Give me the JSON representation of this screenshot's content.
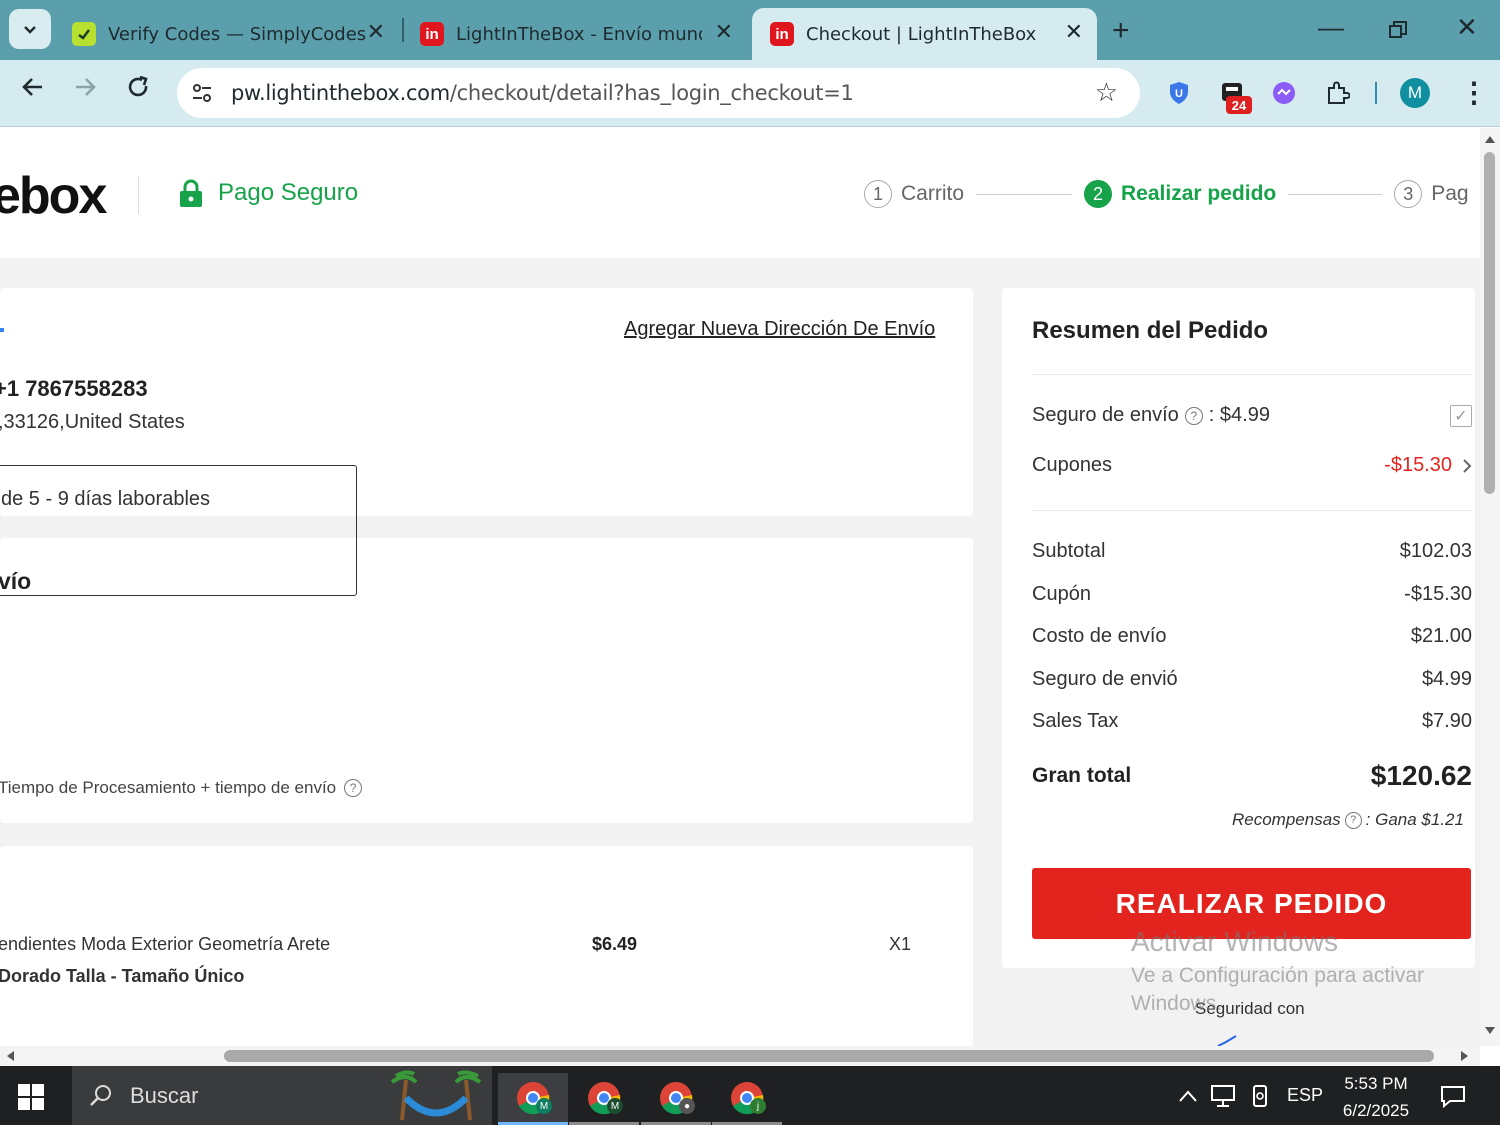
{
  "browser": {
    "tabs": [
      {
        "title": "Verify Codes — SimplyCodes",
        "favicon": "simplycodes-icon"
      },
      {
        "title": "LightInTheBox - Envío mundial",
        "favicon": "lightinthebox-icon"
      },
      {
        "title": "Checkout | LightInTheBox",
        "favicon": "lightinthebox-icon"
      }
    ],
    "url_host": "pw.lightinthebox.com",
    "url_path": "/checkout/detail?has_login_checkout=1",
    "ext_badge": "24",
    "profile_initial": "M"
  },
  "header": {
    "logo": "ebox",
    "secure_label": "Pago Seguro",
    "steps": [
      {
        "num": "1",
        "label": "Carrito"
      },
      {
        "num": "2",
        "label": "Realizar pedido"
      },
      {
        "num": "3",
        "label": "Pag"
      }
    ]
  },
  "address": {
    "add_link": "Agregar Nueva Dirección De Envío",
    "phone": "+1 7867558283",
    "location": ",33126,United States"
  },
  "shipping": {
    "title": "vío",
    "option": "de 5 - 9 días laborables",
    "note": "Tiempo de Procesamiento + tiempo de envío"
  },
  "product": {
    "name": "endientes Moda Exterior Geometría Arete",
    "variant": "Dorado  Talla - Tamaño Único",
    "price": "$6.49",
    "qty": "X1"
  },
  "summary": {
    "title": "Resumen del Pedido",
    "insurance_label": "Seguro de envío",
    "insurance_value": ": $4.99",
    "coupons_label": "Cupones",
    "coupons_value": "-$15.30",
    "rows": [
      {
        "label": "Subtotal",
        "value": "$102.03"
      },
      {
        "label": "Cupón",
        "value": "-$15.30"
      },
      {
        "label": "Costo de envío",
        "value": "$21.00"
      },
      {
        "label": "Seguro de envió",
        "value": "$4.99"
      },
      {
        "label": "Sales Tax",
        "value": "$7.90"
      }
    ],
    "total_label": "Gran total",
    "total_value": "$120.62",
    "rewards_label": "Recompensas",
    "rewards_value": ": Gana $1.21",
    "place_order": "REALIZAR PEDIDO",
    "security": "Seguridad con"
  },
  "watermark": {
    "line1": "Activar Windows",
    "line2": "Ve a Configuración para activar",
    "line3": "Windows."
  },
  "taskbar": {
    "search": "Buscar",
    "lang": "ESP",
    "time": "5:53 PM",
    "date": "6/2/2025"
  },
  "colors": {
    "accent_green": "#16a34a",
    "primary_red": "#e3241e",
    "browser_teal": "#5b9fad"
  }
}
